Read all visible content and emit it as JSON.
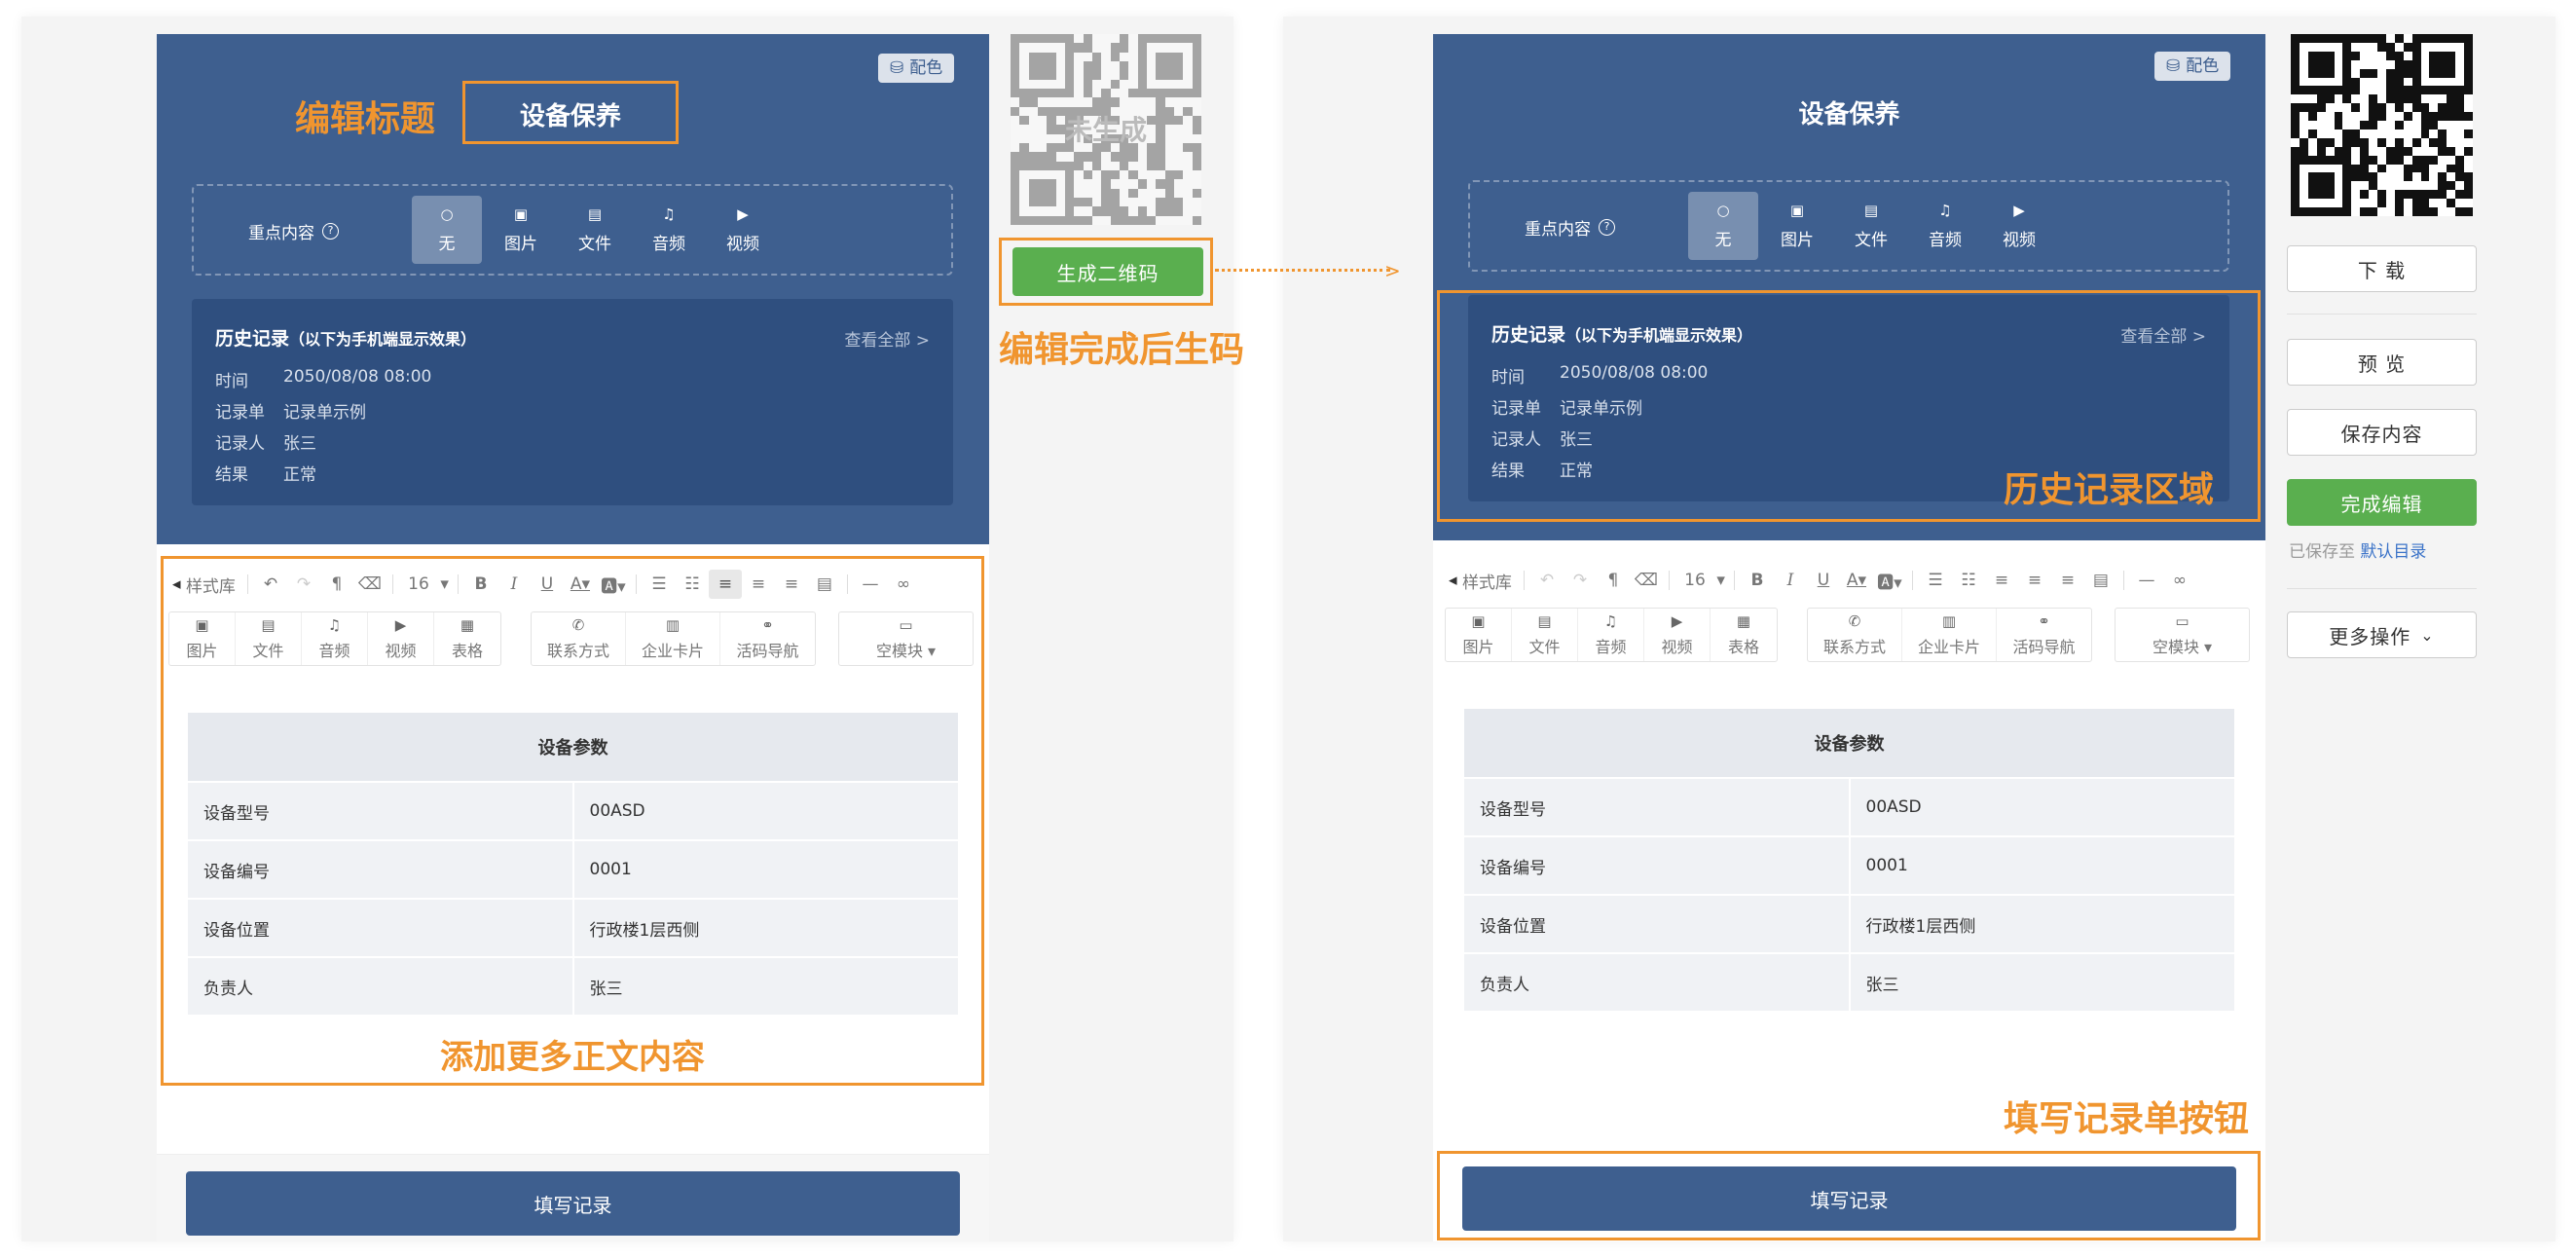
{
  "left": {
    "color_btn": "配色",
    "edit_title_anno": "编辑标题",
    "title": "设备保养",
    "key_content": {
      "label": "重点内容",
      "help": "?",
      "options": [
        {
          "icon": "circle-icon",
          "label": "无",
          "selected": true
        },
        {
          "icon": "image-icon",
          "label": "图片"
        },
        {
          "icon": "file-icon",
          "label": "文件"
        },
        {
          "icon": "music-icon",
          "label": "音频"
        },
        {
          "icon": "video-icon",
          "label": "视频"
        }
      ]
    },
    "qr_placeholder": "未生成",
    "generate_btn": "生成二维码",
    "generate_anno": "编辑完成后生码",
    "add_content_anno": "添加更多正文内容"
  },
  "history": {
    "title": "历史记录",
    "subtitle": "（以下为手机端显示效果）",
    "view_all": "查看全部 >",
    "rows": [
      {
        "key": "时间",
        "value": "2050/08/08 08:00"
      },
      {
        "key": "记录单",
        "value": "记录单示例"
      },
      {
        "key": "记录人",
        "value": "张三"
      },
      {
        "key": "结果",
        "value": "正常"
      }
    ]
  },
  "toolbar": {
    "style_lib": "样式库",
    "font_size": "16",
    "row1_icons": [
      "undo-icon",
      "redo-icon",
      "format-painter-icon",
      "eraser-icon",
      "bold-icon",
      "italic-icon",
      "underline-icon",
      "font-color-icon",
      "bg-color-icon",
      "ordered-list-icon",
      "unordered-list-icon",
      "align-left-icon",
      "align-center-icon",
      "align-right-icon",
      "justify-icon",
      "hr-icon",
      "link-icon"
    ],
    "group1": [
      {
        "icon": "image-icon",
        "label": "图片"
      },
      {
        "icon": "file-icon",
        "label": "文件"
      },
      {
        "icon": "music-icon",
        "label": "音频"
      },
      {
        "icon": "video-icon",
        "label": "视频"
      },
      {
        "icon": "table-icon",
        "label": "表格"
      }
    ],
    "group2": [
      {
        "icon": "phone-icon",
        "label": "联系方式"
      },
      {
        "icon": "building-icon",
        "label": "企业卡片"
      },
      {
        "icon": "link-icon",
        "label": "活码导航"
      }
    ],
    "group3": [
      {
        "icon": "module-icon",
        "label": "空模块 ▾"
      }
    ]
  },
  "params_table": {
    "header": "设备参数",
    "rows": [
      [
        "设备型号",
        "00ASD"
      ],
      [
        "设备编号",
        "0001"
      ],
      [
        "设备位置",
        "行政楼1层西侧"
      ],
      [
        "负责人",
        "张三"
      ]
    ]
  },
  "fill_btn": "填写记录",
  "right": {
    "color_btn": "配色",
    "title": "设备保养",
    "history_anno": "历史记录区域",
    "fill_anno": "填写记录单按钮",
    "side": {
      "download": "下 载",
      "preview": "预 览",
      "save": "保存内容",
      "finish": "完成编辑",
      "saved_prefix": "已保存至",
      "saved_dir": "默认目录",
      "more": "更多操作"
    }
  },
  "colors": {
    "header_bg": "#3e5f8f",
    "history_bg": "#2f4f7f",
    "accent_orange": "#f0952f",
    "green": "#5aaf4f",
    "link_blue": "#3b73c8"
  }
}
